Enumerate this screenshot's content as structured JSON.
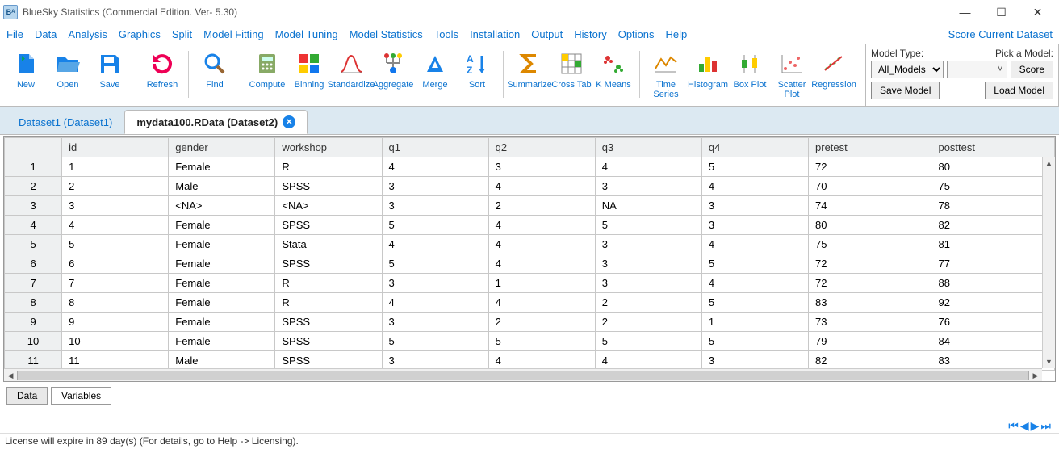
{
  "window": {
    "title": "BlueSky Statistics (Commercial Edition. Ver- 5.30)"
  },
  "menu": [
    "File",
    "Data",
    "Analysis",
    "Graphics",
    "Split",
    "Model Fitting",
    "Model Tuning",
    "Model Statistics",
    "Tools",
    "Installation",
    "Output",
    "History",
    "Options",
    "Help"
  ],
  "right_link": "Score Current Dataset",
  "ribbon": {
    "new": "New",
    "open": "Open",
    "save": "Save",
    "refresh": "Refresh",
    "find": "Find",
    "compute": "Compute",
    "binning": "Binning",
    "standardize": "Standardize",
    "aggregate": "Aggregate",
    "merge": "Merge",
    "sort": "Sort",
    "summarize": "Summarize",
    "crosstab": "Cross Tab",
    "kmeans": "K Means",
    "timeseries": "Time\nSeries",
    "histogram": "Histogram",
    "boxplot": "Box Plot",
    "scatterplot": "Scatter\nPlot",
    "regression": "Regression"
  },
  "model_panel": {
    "model_type_label": "Model Type:",
    "pick_model_label": "Pick a Model:",
    "model_type_value": "All_Models",
    "score_btn": "Score",
    "save_model_btn": "Save Model",
    "load_model_btn": "Load Model"
  },
  "tabs": [
    {
      "label": "Dataset1 (Dataset1)",
      "active": false
    },
    {
      "label": "mydata100.RData (Dataset2)",
      "active": true
    }
  ],
  "columns": [
    "id",
    "gender",
    "workshop",
    "q1",
    "q2",
    "q3",
    "q4",
    "pretest",
    "posttest"
  ],
  "rows": [
    {
      "n": "1",
      "id": "1",
      "gender": "Female",
      "workshop": "R",
      "q1": "4",
      "q2": "3",
      "q3": "4",
      "q4": "5",
      "pretest": "72",
      "posttest": "80"
    },
    {
      "n": "2",
      "id": "2",
      "gender": "Male",
      "workshop": "SPSS",
      "q1": "3",
      "q2": "4",
      "q3": "3",
      "q4": "4",
      "pretest": "70",
      "posttest": "75"
    },
    {
      "n": "3",
      "id": "3",
      "gender": "<NA>",
      "workshop": "<NA>",
      "q1": "3",
      "q2": "2",
      "q3": "NA",
      "q4": "3",
      "pretest": "74",
      "posttest": "78"
    },
    {
      "n": "4",
      "id": "4",
      "gender": "Female",
      "workshop": "SPSS",
      "q1": "5",
      "q2": "4",
      "q3": "5",
      "q4": "3",
      "pretest": "80",
      "posttest": "82"
    },
    {
      "n": "5",
      "id": "5",
      "gender": "Female",
      "workshop": "Stata",
      "q1": "4",
      "q2": "4",
      "q3": "3",
      "q4": "4",
      "pretest": "75",
      "posttest": "81"
    },
    {
      "n": "6",
      "id": "6",
      "gender": "Female",
      "workshop": "SPSS",
      "q1": "5",
      "q2": "4",
      "q3": "3",
      "q4": "5",
      "pretest": "72",
      "posttest": "77"
    },
    {
      "n": "7",
      "id": "7",
      "gender": "Female",
      "workshop": "R",
      "q1": "3",
      "q2": "1",
      "q3": "3",
      "q4": "4",
      "pretest": "72",
      "posttest": "88"
    },
    {
      "n": "8",
      "id": "8",
      "gender": "Female",
      "workshop": "R",
      "q1": "4",
      "q2": "4",
      "q3": "2",
      "q4": "5",
      "pretest": "83",
      "posttest": "92"
    },
    {
      "n": "9",
      "id": "9",
      "gender": "Female",
      "workshop": "SPSS",
      "q1": "3",
      "q2": "2",
      "q3": "2",
      "q4": "1",
      "pretest": "73",
      "posttest": "76"
    },
    {
      "n": "10",
      "id": "10",
      "gender": "Female",
      "workshop": "SPSS",
      "q1": "5",
      "q2": "5",
      "q3": "5",
      "q4": "5",
      "pretest": "79",
      "posttest": "84"
    },
    {
      "n": "11",
      "id": "11",
      "gender": "Male",
      "workshop": "SPSS",
      "q1": "3",
      "q2": "4",
      "q3": "4",
      "q4": "3",
      "pretest": "82",
      "posttest": "83"
    }
  ],
  "bottom_tabs": {
    "data": "Data",
    "variables": "Variables"
  },
  "status": "License will expire in 89 day(s) (For details, go to Help -> Licensing)."
}
